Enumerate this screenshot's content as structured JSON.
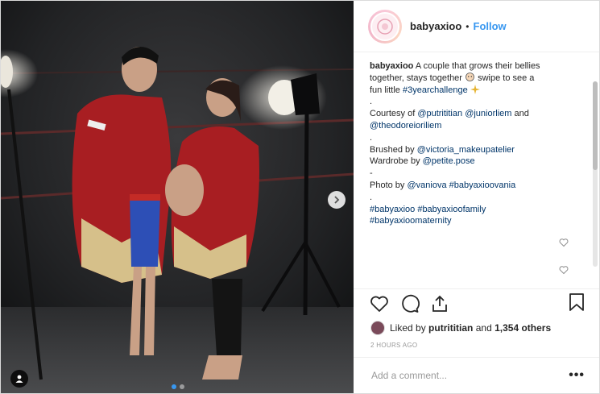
{
  "post": {
    "username": "babyaxioo",
    "separator": "•",
    "follow_label": "Follow",
    "media_alt": "Couple in red boxing robes showing baby bellies",
    "caption": {
      "line1_text": "A couple that grows their bellies",
      "line2": "together, stays together",
      "line2_after": "swipe to see a",
      "line3_before": "fun little",
      "line3_tag": "#3yearchallenge",
      "dot": ".",
      "courtesy_prefix": "Courtesy of",
      "courtesy_user1": "@putrititian",
      "courtesy_user2": "@juniorliem",
      "courtesy_and": "and",
      "courtesy_user3": "@theodoreioriliem",
      "brushed_prefix": "Brushed by",
      "brushed_user": "@victoria_makeupatelier",
      "wardrobe_prefix": "Wardrobe by",
      "wardrobe_user": "@petite.pose",
      "dash": "-",
      "photo_prefix": "Photo by",
      "photo_user": "@vaniova",
      "photo_tag": "#babyaxioovania",
      "tags1": "#babyaxioo #babyaxioofamily",
      "tags2": "#babyaxioomaternity"
    },
    "likes": {
      "prefix": "Liked by",
      "user": "putrititian",
      "and": "and",
      "count": "1,354 others"
    },
    "timestamp": "2 HOURS AGO",
    "comment_placeholder": "Add a comment...",
    "more_label": "•••",
    "icons": [
      "heart-icon",
      "comment-icon",
      "share-icon",
      "bookmark-icon",
      "chevron-right-icon",
      "user-tag-icon"
    ],
    "carousel": {
      "total": 2,
      "active": 1
    },
    "colors": {
      "accent": "#3897f0",
      "text": "#262626",
      "muted": "#999999"
    }
  }
}
